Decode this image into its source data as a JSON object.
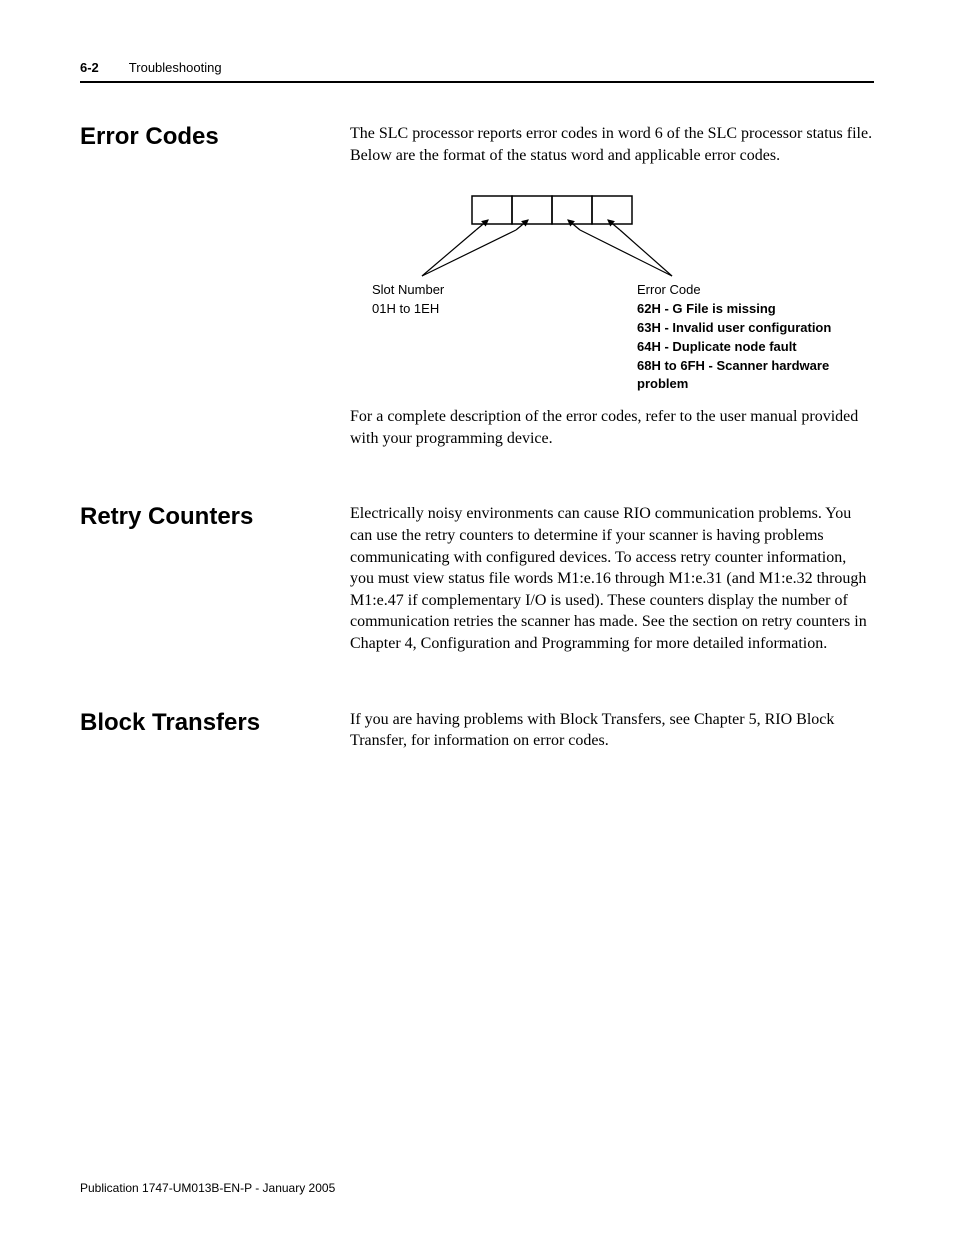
{
  "header": {
    "page_number": "6-2",
    "chapter_title": "Troubleshooting"
  },
  "sections": {
    "error_codes": {
      "heading": "Error Codes",
      "intro": "The SLC processor reports error codes in word 6 of the SLC processor status file. Below are the format of the status word and applicable error codes.",
      "diagram": {
        "slot_number_title": "Slot Number",
        "slot_number_range": "01H to 1EH",
        "error_code_title": "Error Code",
        "codes": {
          "c1": "62H - G File is missing",
          "c2": "63H - Invalid user configuration",
          "c3": "64H - Duplicate node fault",
          "c4": "68H to 6FH - Scanner hardware problem"
        }
      },
      "outro": "For a complete description of the error codes, refer to the user manual provided with your programming device."
    },
    "retry_counters": {
      "heading": "Retry Counters",
      "body": "Electrically noisy environments can cause RIO communication problems. You can use the retry counters to determine if your scanner is having problems communicating with configured devices. To access retry counter information, you must view status file words M1:e.16 through M1:e.31 (and M1:e.32 through M1:e.47 if complementary I/O is used). These counters display the number of communication retries the scanner has made. See the section on retry counters in Chapter 4, Configuration and Programming for more detailed information."
    },
    "block_transfers": {
      "heading": "Block Transfers",
      "body": "If you are having problems with Block Transfers, see Chapter 5, RIO Block Transfer, for information on error codes."
    }
  },
  "footer": {
    "publication": "Publication 1747-UM013B-EN-P - January 2005"
  }
}
